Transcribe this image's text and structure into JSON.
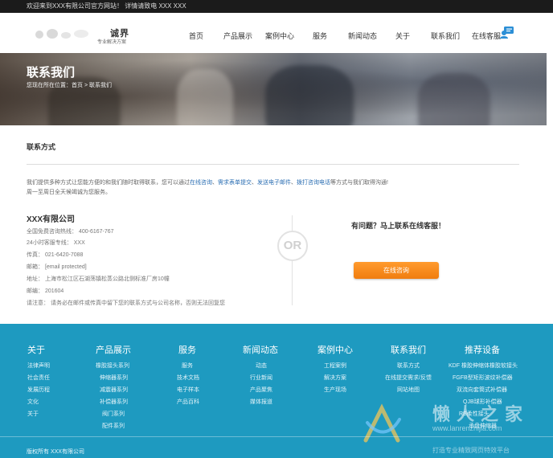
{
  "topbar": {
    "text": "欢迎来到XXX有限公司官方网站！ 详情请致电 XXX  XXX"
  },
  "header": {
    "logo_title": "诚界",
    "logo_sub": "专业解决方案",
    "nav": [
      "首页",
      "产品展示",
      "案例中心",
      "服务",
      "新闻动态",
      "关于",
      "联系我们",
      "在线客服"
    ]
  },
  "banner": {
    "title": "联系我们",
    "crumb_prefix": "您现在所在位置：",
    "crumb_home": "首页",
    "crumb_sep": " > ",
    "crumb_current": "联系我们"
  },
  "contact": {
    "section_title": "联系方式",
    "intro_1": "我们提供多种方式让您能方便的和我们随时取得联系，您可以通过",
    "intro_links": [
      "在线咨询",
      "需求表单提交",
      "发送电子邮件",
      "拨打咨询电话"
    ],
    "intro_seps": [
      "、",
      "、",
      "、"
    ],
    "intro_2": "等方式与我们取得沟通!",
    "intro_3": "周一至周日全天候竭诚为您服务。",
    "company": "XXX有限公司",
    "lines": [
      "全国免费咨询热线：  400-6167-767",
      "24小时客服专线：  XXX",
      "传真：  021-6420-7088",
      "邮箱：  [email protected]",
      "地址：  上海市松江区石湖荡镇松蒸公路北侧标准厂房10幢",
      "邮编：  201604",
      "请注意：  请务必在邮件或传真中留下您的联系方式与公司名称，否则无法回复您"
    ],
    "or_text": "OR",
    "ask_text": "有问题？马上联系在线客服！",
    "consult_label": "在线咨询"
  },
  "footer": {
    "columns": [
      {
        "head": "关于",
        "items": [
          "法律声明",
          "社会责任",
          "发展历程",
          "文化",
          "关于"
        ]
      },
      {
        "head": "产品展示",
        "items": [
          "橡胶接头系列",
          "伸缩器系列",
          "减震器系列",
          "补偿器系列",
          "阀门系列",
          "配件系列"
        ]
      },
      {
        "head": "服务",
        "items": [
          "服务",
          "技术文档",
          "电子样本",
          "产品百科"
        ]
      },
      {
        "head": "新闻动态",
        "items": [
          "动态",
          "行业新闻",
          "产品聚焦",
          "媒体报道"
        ]
      },
      {
        "head": "案例中心",
        "items": [
          "工程案例",
          "解决方案",
          "生产现场"
        ]
      },
      {
        "head": "联系我们",
        "items": [
          "联系方式",
          "在线提交需求/反馈",
          "网站地图"
        ]
      },
      {
        "head": "推荐设备",
        "items": [
          "KDF 橡胶伸缩体橡胶软接头",
          "FGFB型矩形波纹补偿器",
          "双流向套筒式补偿器",
          "QJB球形补偿器",
          "RS柔性接头",
          "承盘伸缩器"
        ]
      }
    ],
    "copyright": "版权所有 XXX有限公司",
    "watermark_text": "懒人之家",
    "watermark_url": "www.lanrenzhijia.com",
    "watermark_slogan": "打造专业精致网页特效平台"
  },
  "colors": {
    "footer_bg": "#1e9ac0",
    "button": "#f07d0f",
    "link": "#2c6fb3",
    "topbar": "#1b1b1b"
  }
}
